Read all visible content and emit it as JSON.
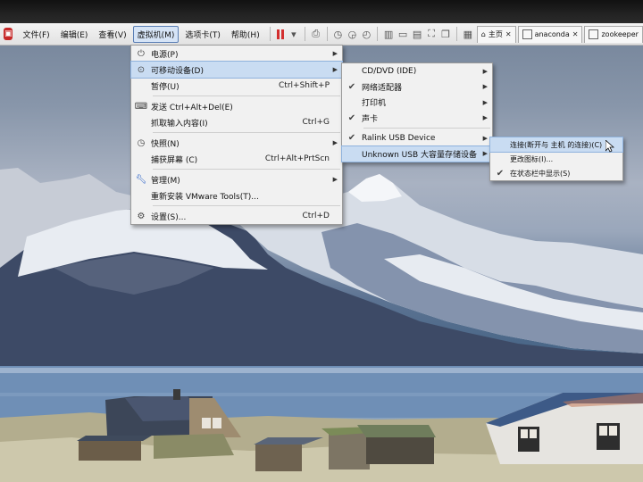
{
  "menubar": {
    "items": [
      "文件(F)",
      "编辑(E)",
      "查看(V)",
      "虚拟机(M)",
      "选项卡(T)",
      "帮助(H)"
    ],
    "active_index": 3
  },
  "tabs": [
    {
      "label": "主页",
      "icon": "home-icon"
    },
    {
      "label": "anaconda",
      "icon": "vm-icon"
    },
    {
      "label": "zookeeper",
      "icon": "vm-icon"
    }
  ],
  "vm_menu": {
    "power": "电源(P)",
    "removable": "可移动设备(D)",
    "pause": "暂停(U)",
    "pause_shortcut": "Ctrl+Shift+P",
    "send_cad": "发送 Ctrl+Alt+Del(E)",
    "grab_input": "抓取输入内容(I)",
    "grab_shortcut": "Ctrl+G",
    "snapshot": "快照(N)",
    "capture_screen": "捕获屏幕 (C)",
    "capture_shortcut": "Ctrl+Alt+PrtScn",
    "manage": "管理(M)",
    "reinstall_tools": "重新安装 VMware Tools(T)...",
    "settings": "设置(S)...",
    "settings_shortcut": "Ctrl+D"
  },
  "devices_menu": {
    "cddvd": "CD/DVD (IDE)",
    "network": "网络适配器",
    "printer": "打印机",
    "sound": "声卡",
    "ralink": "Ralink USB Device",
    "unknown_usb": "Unknown USB 大容量存储设备"
  },
  "usb_menu": {
    "connect": "连接(断开与 主机 的连接)(C)",
    "change_icon": "更改图标(I)...",
    "show_in_status": "在状态栏中显示(S)"
  }
}
